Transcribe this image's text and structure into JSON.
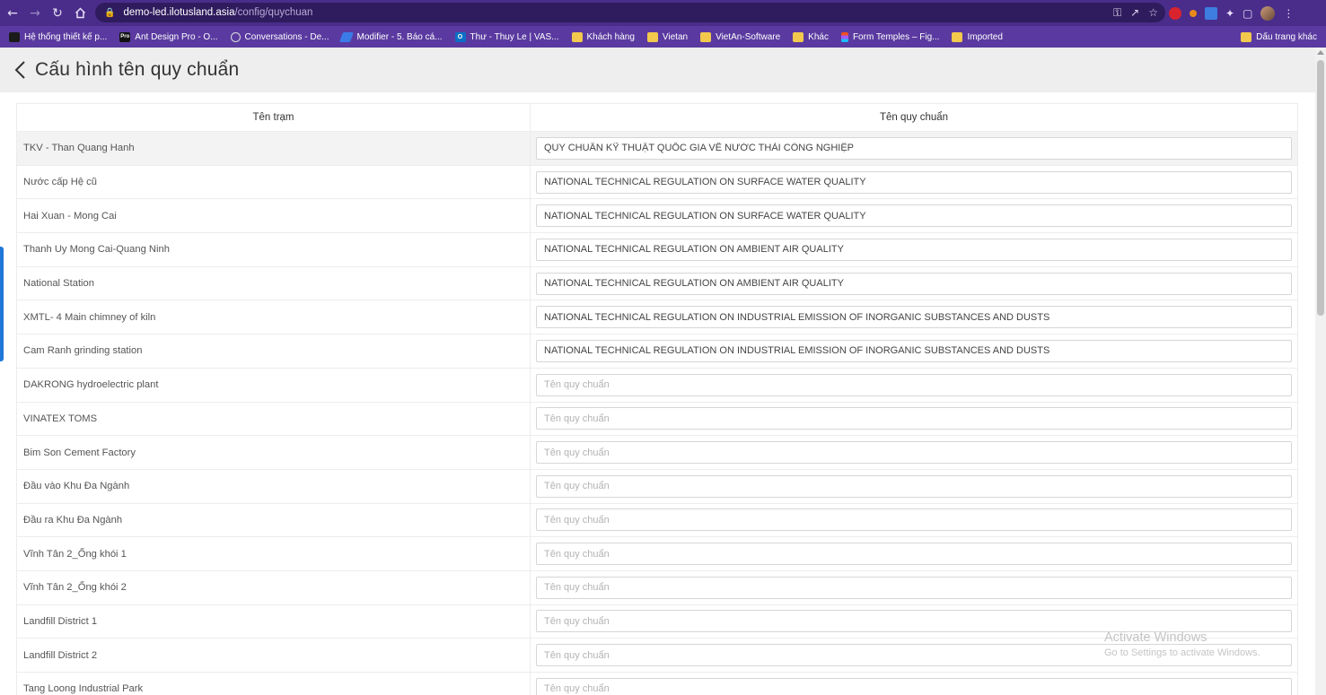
{
  "browser": {
    "url_host": "demo-led.ilotusland.asia",
    "url_path": "/config/quychuan",
    "bookmarks": [
      {
        "label": "Hệ thống thiết kế p...",
        "icon": "zoom-icon"
      },
      {
        "label": "Ant Design Pro - O...",
        "icon": "pro-icon"
      },
      {
        "label": "Conversations - De...",
        "icon": "conversations-icon"
      },
      {
        "label": "Modifier - 5. Báo cá...",
        "icon": "modifier-icon"
      },
      {
        "label": "Thư - Thuy Le | VAS...",
        "icon": "outlook-icon"
      },
      {
        "label": "Khách hàng",
        "icon": "folder-icon"
      },
      {
        "label": "Vietan",
        "icon": "folder-icon"
      },
      {
        "label": "VietAn-Software",
        "icon": "folder-icon"
      },
      {
        "label": "Khác",
        "icon": "folder-icon"
      },
      {
        "label": "Form Temples – Fig...",
        "icon": "figma-icon"
      },
      {
        "label": "Imported",
        "icon": "folder-icon"
      }
    ],
    "other_bookmarks": "Dấu trang khác"
  },
  "page": {
    "title": "Cấu hình tên quy chuẩn"
  },
  "table": {
    "headers": [
      "Tên trạm",
      "Tên quy chuẩn"
    ],
    "placeholder": "Tên quy chuẩn",
    "rows": [
      {
        "station": "TKV - Than Quang Hanh",
        "standard": "QUY CHUẨN KỸ THUẬT QUỐC GIA VỀ NƯỚC THẢI CÔNG NGHIỆP"
      },
      {
        "station": "Nước cấp Hệ cũ",
        "standard": "NATIONAL TECHNICAL REGULATION ON SURFACE WATER QUALITY"
      },
      {
        "station": "Hai Xuan - Mong Cai",
        "standard": "NATIONAL TECHNICAL REGULATION ON SURFACE WATER QUALITY"
      },
      {
        "station": "Thanh Uy Mong Cai-Quang Ninh",
        "standard": "NATIONAL TECHNICAL REGULATION ON AMBIENT AIR QUALITY"
      },
      {
        "station": "National Station",
        "standard": "NATIONAL TECHNICAL REGULATION ON AMBIENT AIR QUALITY"
      },
      {
        "station": "XMTL- 4 Main chimney of kiln",
        "standard": "NATIONAL TECHNICAL REGULATION ON INDUSTRIAL EMISSION OF INORGANIC SUBSTANCES AND DUSTS"
      },
      {
        "station": "Cam Ranh grinding station",
        "standard": "NATIONAL TECHNICAL REGULATION ON INDUSTRIAL EMISSION OF INORGANIC SUBSTANCES AND DUSTS"
      },
      {
        "station": "DAKRONG hydroelectric plant",
        "standard": ""
      },
      {
        "station": "VINATEX TOMS",
        "standard": ""
      },
      {
        "station": "Bim Son Cement Factory",
        "standard": ""
      },
      {
        "station": "Đầu vào Khu Đa Ngành",
        "standard": ""
      },
      {
        "station": "Đầu ra Khu Đa Ngành",
        "standard": ""
      },
      {
        "station": "Vĩnh Tân 2_Ống khói 1",
        "standard": ""
      },
      {
        "station": "Vĩnh Tân 2_Ống khói 2",
        "standard": ""
      },
      {
        "station": "Landfill District 1",
        "standard": ""
      },
      {
        "station": "Landfill District 2",
        "standard": ""
      },
      {
        "station": "Tang Loong Industrial Park",
        "standard": ""
      }
    ]
  },
  "watermark": {
    "title": "Activate Windows",
    "subtitle": "Go to Settings to activate Windows."
  }
}
